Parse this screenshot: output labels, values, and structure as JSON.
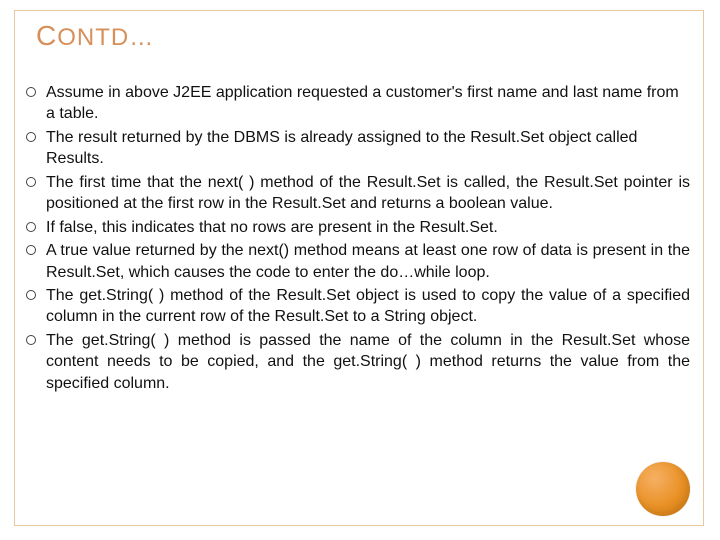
{
  "title_parts": {
    "first": "C",
    "rest": "ONTD…"
  },
  "bullets": [
    {
      "text": "Assume in above J2EE application requested a customer's first name and last name from a table.",
      "justify": false
    },
    {
      "text": "The result returned by the DBMS is already assigned to the Result.Set object called Results.",
      "justify": false
    },
    {
      "text": "The first time that the next( ) method of the Result.Set is called, the Result.Set pointer is positioned at the first row in the Result.Set and returns a boolean value.",
      "justify": true
    },
    {
      "text": "If false, this indicates that no rows are present in the Result.Set.",
      "justify": false
    },
    {
      "text": "A true value returned by the next() method means at least one row of data is present in the Result.Set, which causes the code to enter the do…while loop.",
      "justify": true
    },
    {
      "text": "The get.String( ) method of the Result.Set object is used to copy the value of a specified column in the current row of the Result.Set to a String object.",
      "justify": true
    },
    {
      "text": "The get.String( ) method is passed the name of the column in the Result.Set whose content needs to be copied, and the get.String( ) method returns the value from the specified column.",
      "justify": true
    }
  ]
}
